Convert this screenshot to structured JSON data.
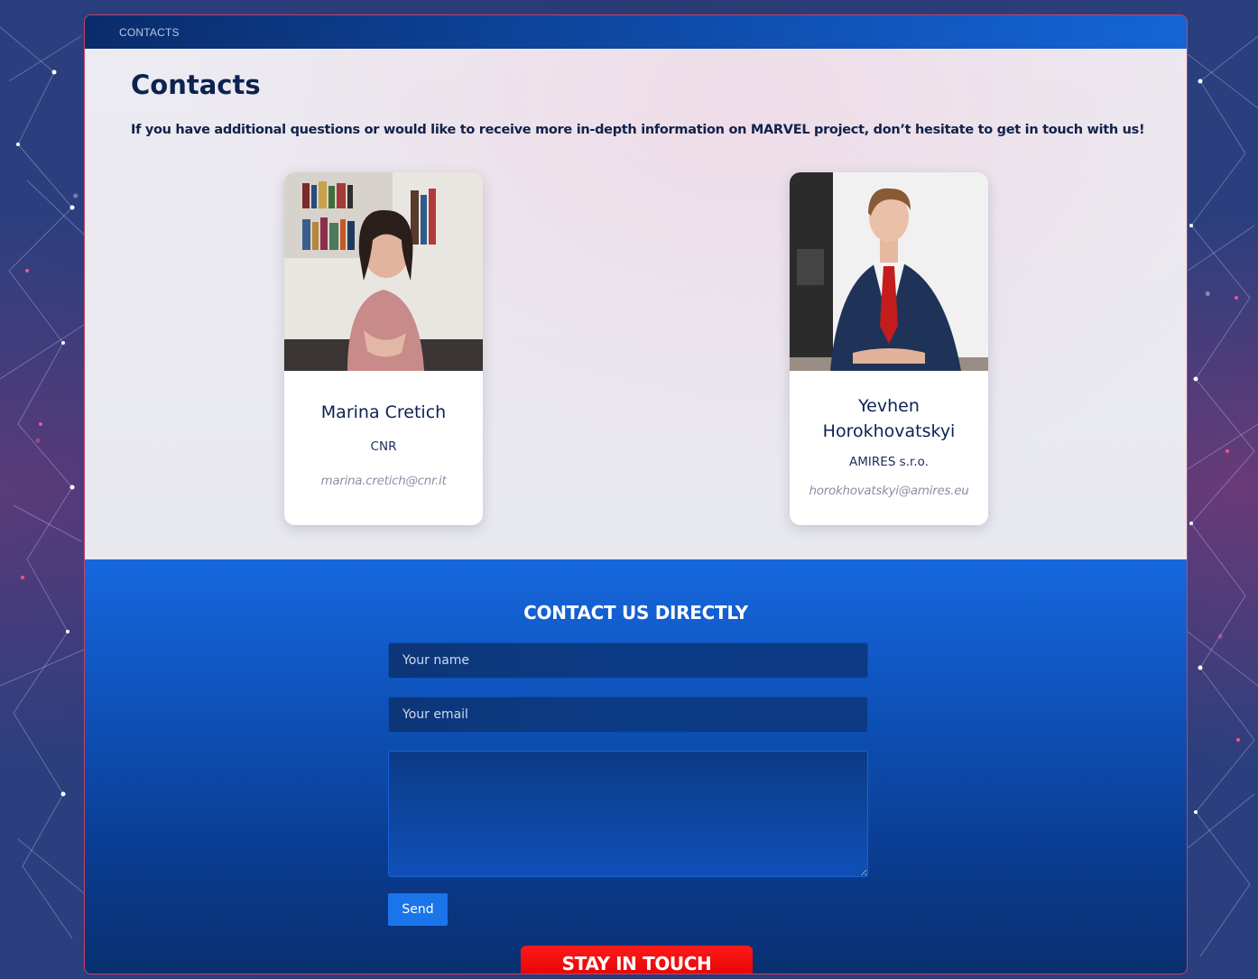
{
  "breadcrumb": {
    "label": "CONTACTS"
  },
  "page": {
    "title": "Contacts",
    "lead": "If you have additional questions or would like to receive more in-depth information on MARVEL project, don’t hesitate to get in touch with us!"
  },
  "contacts": [
    {
      "name": "Marina Cretich",
      "org": "CNR",
      "email": "marina.cretich@cnr.it"
    },
    {
      "name": "Yevhen Horokhovatskyi",
      "org": "AMIRES s.r.o.",
      "email": "horokhovatskyi@amires.eu"
    }
  ],
  "form": {
    "title": "CONTACT US DIRECTLY",
    "name_placeholder": "Your name",
    "email_placeholder": "Your email",
    "message_placeholder": "",
    "send_label": "Send"
  },
  "footer": {
    "stay_label": "STAY IN TOUCH"
  },
  "colors": {
    "accent": "#1a74ea",
    "title": "#0c2350",
    "stay": "#e00000",
    "dark_bg": "#0d4fb4"
  }
}
